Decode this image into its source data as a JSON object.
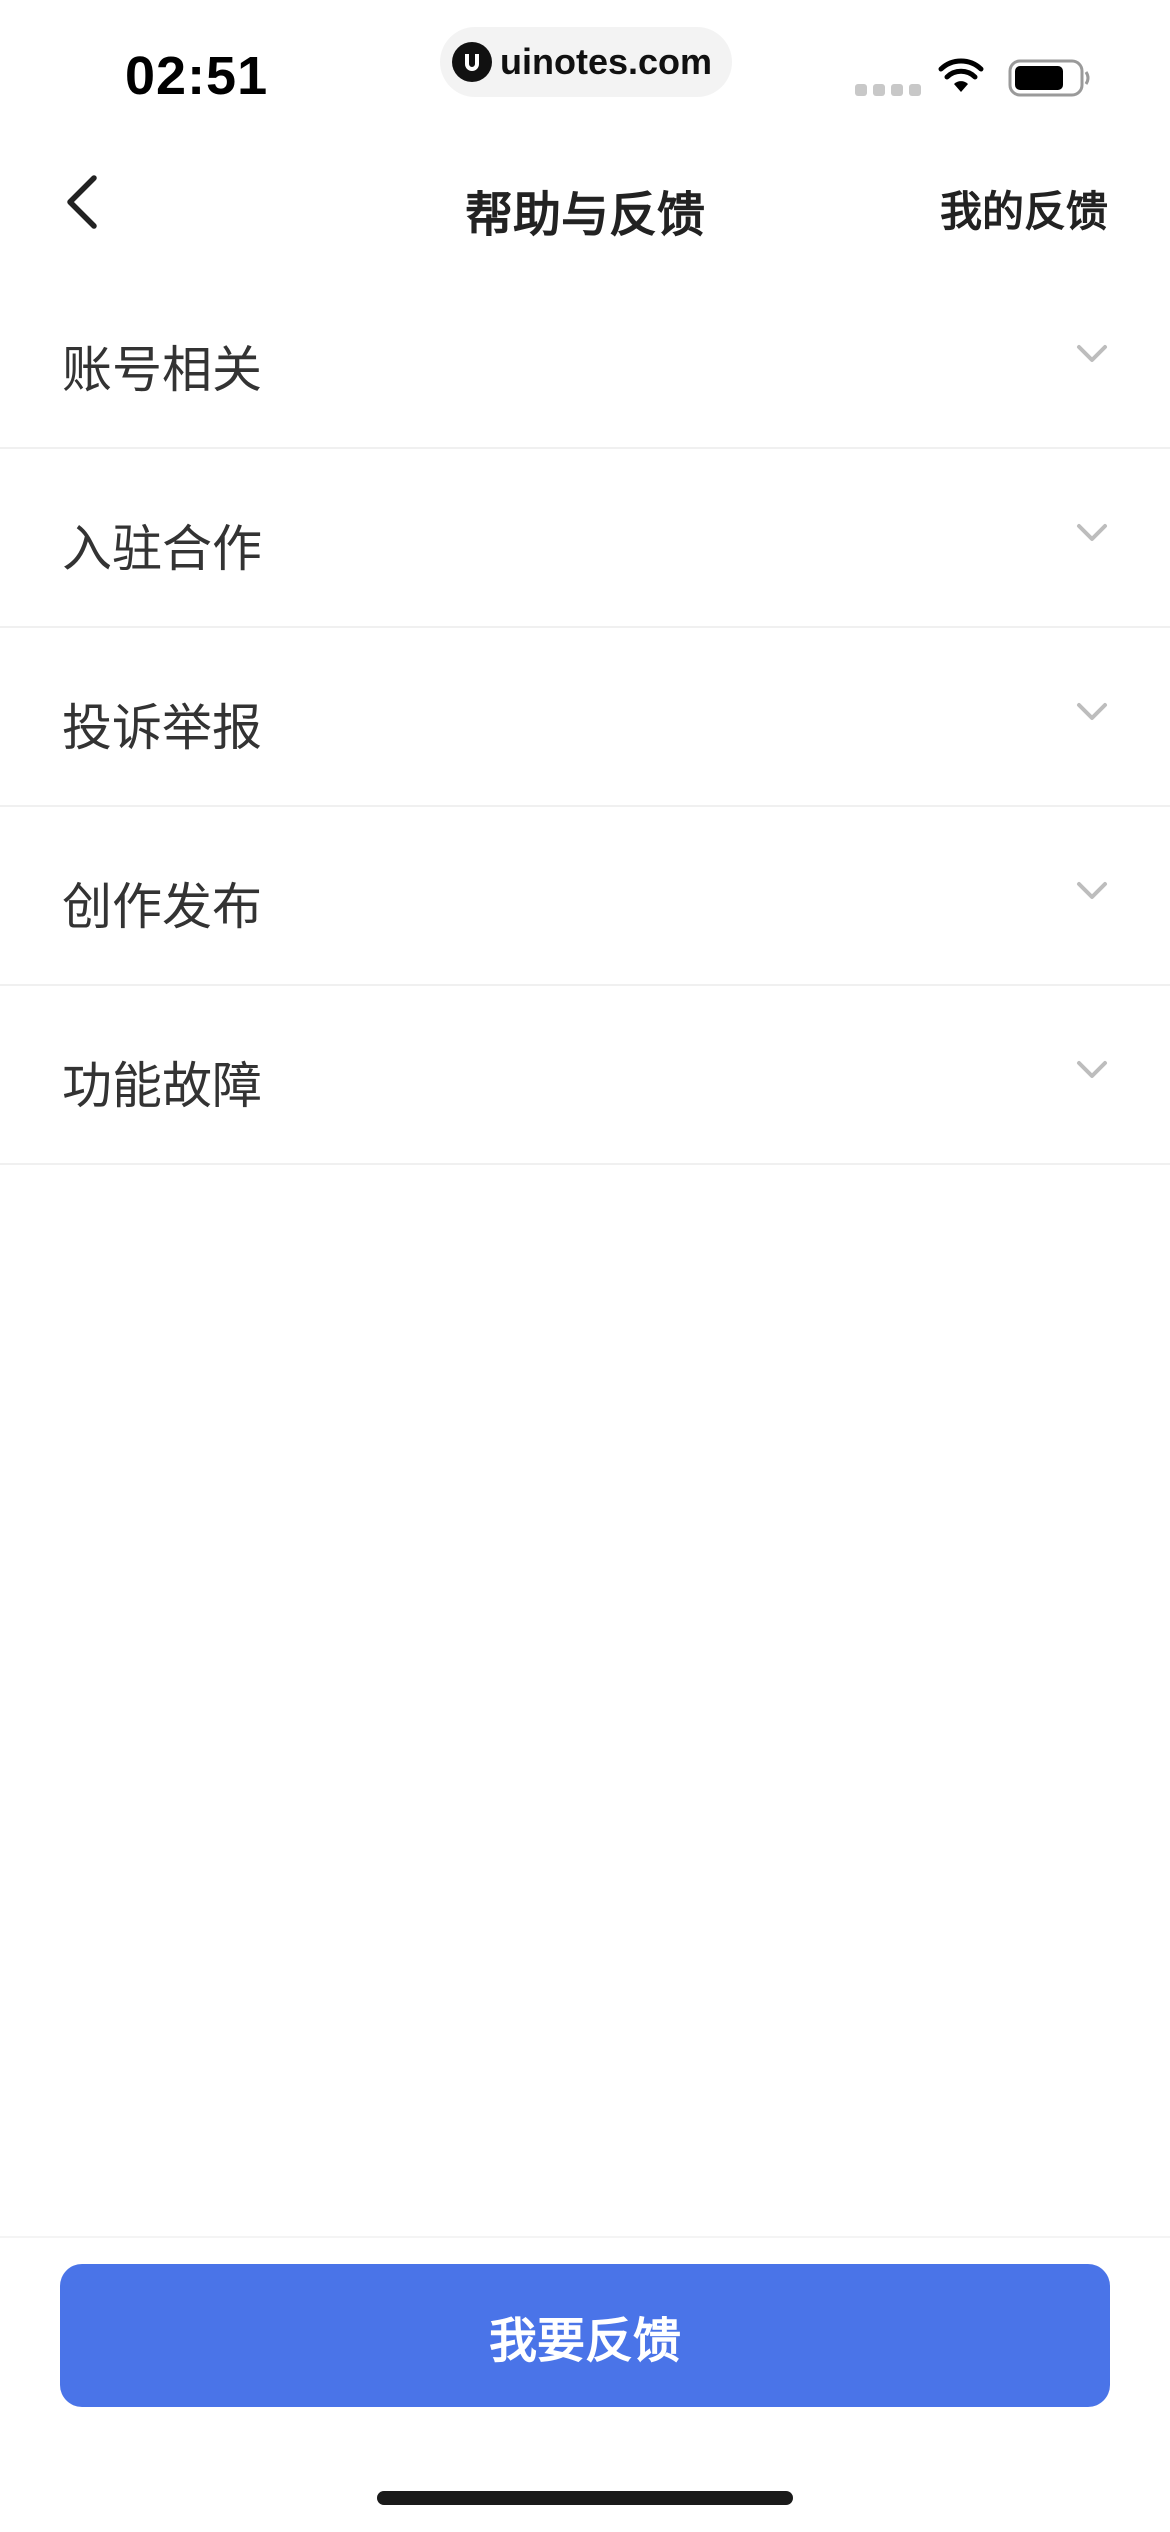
{
  "status_bar": {
    "time": "02:51",
    "site": "uinotes.com",
    "icons": [
      "signal-icon",
      "wifi-icon",
      "battery-icon"
    ]
  },
  "nav": {
    "title": "帮助与反馈",
    "right_action": "我的反馈",
    "back_icon": "chevron-left-icon"
  },
  "faq": {
    "items": [
      {
        "label": "账号相关",
        "icon": "chevron-down-icon"
      },
      {
        "label": "入驻合作",
        "icon": "chevron-down-icon"
      },
      {
        "label": "投诉举报",
        "icon": "chevron-down-icon"
      },
      {
        "label": "创作发布",
        "icon": "chevron-down-icon"
      },
      {
        "label": "功能故障",
        "icon": "chevron-down-icon"
      }
    ]
  },
  "actions": {
    "feedback_label": "我要反馈"
  },
  "colors": {
    "accent": "#4a74e8",
    "text": "#333333",
    "divider": "#f0f0f0",
    "chevron": "#bdbdbd"
  }
}
